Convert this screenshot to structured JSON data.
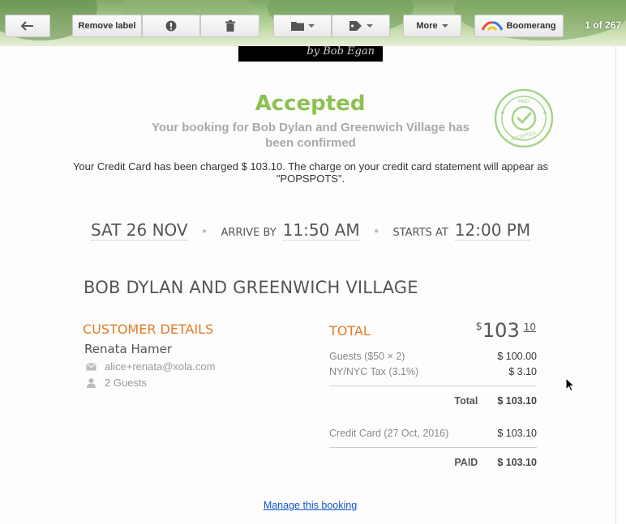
{
  "toolbar": {
    "remove_label": "Remove label",
    "more_label": "More",
    "boomerang_label": "Boomerang",
    "counter": "1 of 267",
    "icons": [
      "back-arrow-icon",
      "report-spam-icon",
      "trash-icon",
      "folder-icon",
      "tag-icon",
      "boomerang-logo-icon"
    ]
  },
  "email": {
    "banner_text": "by Bob Egan",
    "status": "Accepted",
    "confirmation": "Your booking for Bob Dylan and Greenwich Village has been confirmed",
    "charge_note": "Your Credit Card has been charged $ 103.10. The charge on your credit card statement will appear as \"POPSPOTS\".",
    "stamp": {
      "top": "PAID",
      "bottom": "ACCEPTED",
      "color": "#a8d38a"
    },
    "schedule": {
      "date": "SAT 26 NOV",
      "arrive_label": "ARRIVE BY",
      "arrive_time": "11:50 AM",
      "starts_label": "STARTS AT",
      "start_time": "12:00 PM"
    },
    "event_title": "BOB DYLAN AND GREENWICH VILLAGE",
    "customer": {
      "heading": "CUSTOMER DETAILS",
      "name": "Renata Hamer",
      "email": "alice+renata@xola.com",
      "guests": "2 Guests"
    },
    "totals": {
      "heading": "TOTAL",
      "currency_symbol": "$",
      "amount_dollars": "103",
      "amount_cents": "10",
      "lines": [
        {
          "label": "Guests ($50 × 2)",
          "value": "$ 100.00"
        },
        {
          "label": "NY/NYC Tax (3.1%)",
          "value": "$ 3.10"
        }
      ],
      "total_label": "Total",
      "total_value": "$ 103.10",
      "payment_label": "Credit Card (27 Oct, 2016)",
      "payment_value": "$ 103.10",
      "paid_label": "PAID",
      "paid_value": "$ 103.10"
    },
    "manage_link": "Manage this booking"
  },
  "colors": {
    "accent_green": "#8cc152",
    "accent_orange": "#e07a27",
    "link_blue": "#1155cc"
  }
}
